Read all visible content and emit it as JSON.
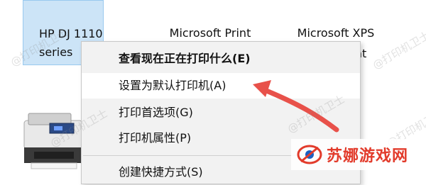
{
  "devices": [
    {
      "label_line1": "HP DJ 1110",
      "label_line2": "series"
    },
    {
      "label_line1": "Microsoft Print",
      "label_line2": ""
    },
    {
      "label_line1": "Microsoft XPS",
      "label_line2": "ent"
    }
  ],
  "context_menu": {
    "items": [
      {
        "label": "查看现在正在打印什么(E)"
      },
      {
        "label": "设置为默认打印机(A)"
      },
      {
        "label": "打印首选项(G)"
      },
      {
        "label": "打印机属性(P)"
      },
      {
        "label": "创建快捷方式(S)"
      }
    ]
  },
  "watermark": {
    "text": "@打印机卫士"
  },
  "logo": {
    "text": "苏娜游戏网",
    "color": "#e23b2b"
  },
  "colors": {
    "selection_bg": "#cce4f7",
    "selection_border": "#99c9ef",
    "arrow": "#e8514a"
  }
}
